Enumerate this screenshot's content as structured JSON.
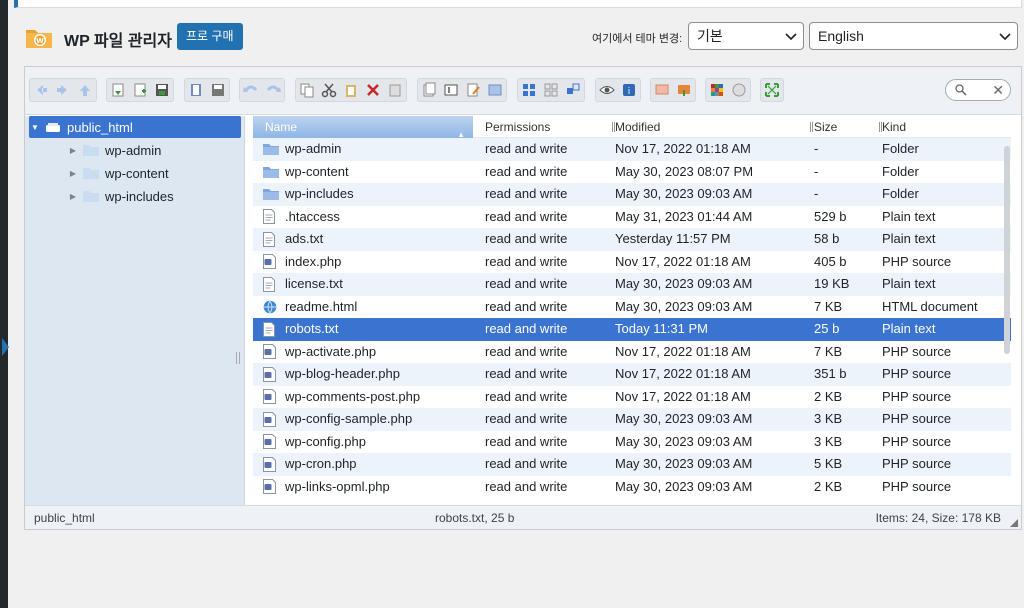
{
  "header": {
    "title": "WP 파일 관리자",
    "buy_label": "프로 구매",
    "theme_label": "여기에서 테마 변경:",
    "theme_value": "기본",
    "language_value": "English"
  },
  "colors": {
    "accent": "#2271b1",
    "selection": "#3a74d0",
    "tree_bg": "#dde7f2",
    "row_alt": "#edf3fb"
  },
  "toolbar": {
    "search_clear": "✕"
  },
  "tree": {
    "items": [
      {
        "label": "public_html",
        "selected": true,
        "icon": "drive-icon"
      },
      {
        "label": "wp-admin",
        "selected": false,
        "icon": "folder-icon"
      },
      {
        "label": "wp-content",
        "selected": false,
        "icon": "folder-icon"
      },
      {
        "label": "wp-includes",
        "selected": false,
        "icon": "folder-icon"
      }
    ]
  },
  "list": {
    "columns": {
      "name": "Name",
      "permissions": "Permissions",
      "modified": "Modified",
      "size": "Size",
      "kind": "Kind"
    },
    "rows": [
      {
        "name": "wp-admin",
        "perm": "read and write",
        "mod": "Nov 17, 2022 01:18 AM",
        "size": "-",
        "kind": "Folder",
        "icon": "folder"
      },
      {
        "name": "wp-content",
        "perm": "read and write",
        "mod": "May 30, 2023 08:07 PM",
        "size": "-",
        "kind": "Folder",
        "icon": "folder"
      },
      {
        "name": "wp-includes",
        "perm": "read and write",
        "mod": "May 30, 2023 09:03 AM",
        "size": "-",
        "kind": "Folder",
        "icon": "folder"
      },
      {
        "name": ".htaccess",
        "perm": "read and write",
        "mod": "May 31, 2023 01:44 AM",
        "size": "529 b",
        "kind": "Plain text",
        "icon": "text"
      },
      {
        "name": "ads.txt",
        "perm": "read and write",
        "mod": "Yesterday 11:57 PM",
        "size": "58 b",
        "kind": "Plain text",
        "icon": "text"
      },
      {
        "name": "index.php",
        "perm": "read and write",
        "mod": "Nov 17, 2022 01:18 AM",
        "size": "405 b",
        "kind": "PHP source",
        "icon": "php"
      },
      {
        "name": "license.txt",
        "perm": "read and write",
        "mod": "May 30, 2023 09:03 AM",
        "size": "19 KB",
        "kind": "Plain text",
        "icon": "text"
      },
      {
        "name": "readme.html",
        "perm": "read and write",
        "mod": "May 30, 2023 09:03 AM",
        "size": "7 KB",
        "kind": "HTML document",
        "icon": "html"
      },
      {
        "name": "robots.txt",
        "perm": "read and write",
        "mod": "Today 11:31 PM",
        "size": "25 b",
        "kind": "Plain text",
        "icon": "text",
        "selected": true
      },
      {
        "name": "wp-activate.php",
        "perm": "read and write",
        "mod": "Nov 17, 2022 01:18 AM",
        "size": "7 KB",
        "kind": "PHP source",
        "icon": "php"
      },
      {
        "name": "wp-blog-header.php",
        "perm": "read and write",
        "mod": "Nov 17, 2022 01:18 AM",
        "size": "351 b",
        "kind": "PHP source",
        "icon": "php"
      },
      {
        "name": "wp-comments-post.php",
        "perm": "read and write",
        "mod": "Nov 17, 2022 01:18 AM",
        "size": "2 KB",
        "kind": "PHP source",
        "icon": "php"
      },
      {
        "name": "wp-config-sample.php",
        "perm": "read and write",
        "mod": "May 30, 2023 09:03 AM",
        "size": "3 KB",
        "kind": "PHP source",
        "icon": "php"
      },
      {
        "name": "wp-config.php",
        "perm": "read and write",
        "mod": "May 30, 2023 09:03 AM",
        "size": "3 KB",
        "kind": "PHP source",
        "icon": "php"
      },
      {
        "name": "wp-cron.php",
        "perm": "read and write",
        "mod": "May 30, 2023 09:03 AM",
        "size": "5 KB",
        "kind": "PHP source",
        "icon": "php"
      },
      {
        "name": "wp-links-opml.php",
        "perm": "read and write",
        "mod": "May 30, 2023 09:03 AM",
        "size": "2 KB",
        "kind": "PHP source",
        "icon": "php"
      }
    ]
  },
  "status": {
    "path": "public_html",
    "selection": "robots.txt, 25 b",
    "summary": "Items: 24, Size: 178 KB"
  }
}
